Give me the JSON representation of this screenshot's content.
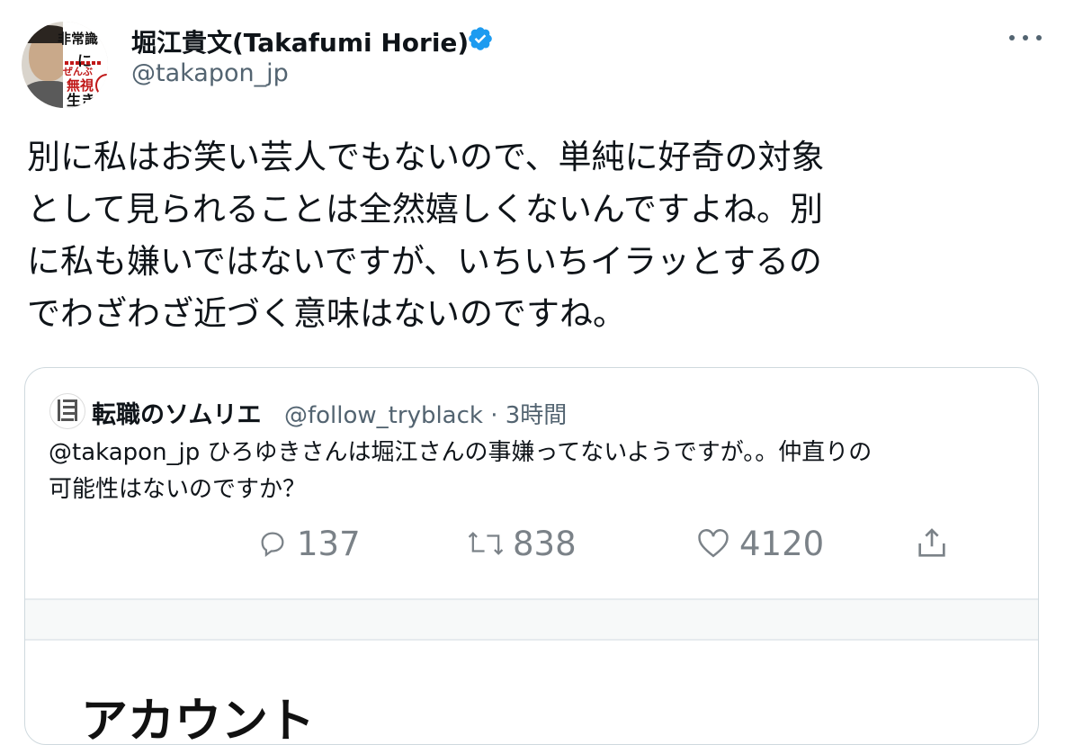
{
  "tweet": {
    "author_name": "堀江貴文(Takafumi Horie)",
    "author_handle": "@takapon_jp",
    "verified_icon": "verified-badge-icon",
    "more_icon": "more-options-icon",
    "avatar_text": [
      "非常識",
      "に",
      "ぜんぶ",
      "無視",
      "生き"
    ],
    "body_lines": [
      "別に私はお笑い芸人でもないので、単純に好奇の対象",
      "として見られることは全然嬉しくないんですよね。別",
      "に私も嫌いではないですが、いちいちイラッとするの",
      "でわざわざ近づく意味はないのですね。"
    ]
  },
  "quoted_tweet": {
    "author_name": "転職のソムリエ",
    "author_handle": "@follow_tryblack",
    "separator": "·",
    "time": "3時間",
    "text_lines": [
      "@takapon_jp ひろゆきさんは堀江さんの事嫌ってないようですが。。仲直りの",
      "可能性はないのですか？"
    ],
    "actions": {
      "reply_count": "137",
      "retweet_count": "838",
      "like_count": "4120"
    },
    "embedded_heading": "アカウント"
  },
  "colors": {
    "text": "#0f1419",
    "secondary": "#536471",
    "verified": "#1d9bf0",
    "border": "#cfd9de"
  }
}
